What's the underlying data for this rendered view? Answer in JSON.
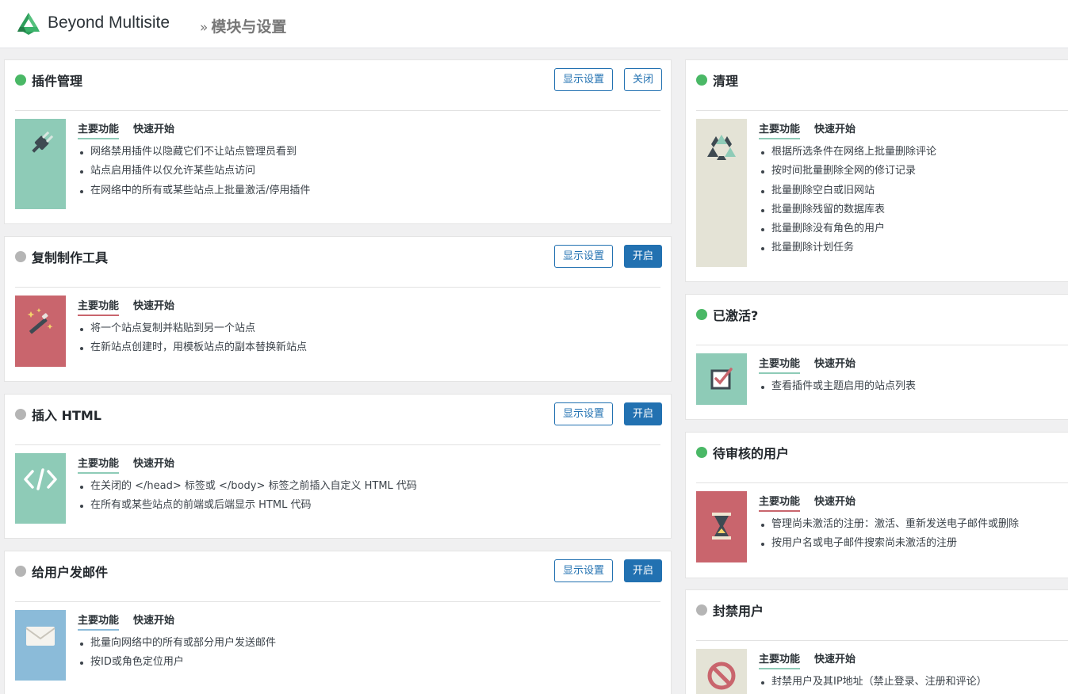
{
  "header": {
    "brand": "Beyond Multisite",
    "breadcrumb_sep": "»",
    "page_title": "模块与设置"
  },
  "colors": {
    "green_thumb": "#8ecbb7",
    "red_thumb": "#c9656d",
    "blue_thumb": "#8bbbd9",
    "beige_thumb": "#e4e3d6",
    "active_dot": "#4ab866",
    "inactive_dot": "#b5b5b5",
    "button_blue": "#2271b1"
  },
  "tab_main": "主要功能",
  "tab_quick": "快速开始",
  "modules": {
    "plugin_manager": {
      "title": "插件管理",
      "status": "active",
      "icon": "plug-icon",
      "settings_label": "显示设置",
      "toggle_label": "关闭",
      "features": [
        "网络禁用插件以隐藏它们不让站点管理员看到",
        "站点启用插件以仅允许某些站点访问",
        "在网络中的所有或某些站点上批量激活/停用插件"
      ]
    },
    "copier": {
      "title": "复制制作工具",
      "status": "inactive",
      "icon": "magic-wand-icon",
      "settings_label": "显示设置",
      "toggle_label": "开启",
      "features": [
        "将一个站点复制并粘贴到另一个站点",
        "在新站点创建时，用模板站点的副本替换新站点"
      ]
    },
    "insert_html": {
      "title": "插入 HTML",
      "status": "inactive",
      "icon": "code-icon",
      "settings_label": "显示设置",
      "toggle_label": "开启",
      "features": [
        "在关闭的 </head> 标签或 </body> 标签之前插入自定义 HTML 代码",
        "在所有或某些站点的前端或后端显示 HTML 代码"
      ]
    },
    "email_users": {
      "title": "给用户发邮件",
      "status": "inactive",
      "icon": "envelope-icon",
      "settings_label": "显示设置",
      "toggle_label": "开启",
      "features": [
        "批量向网络中的所有或部分用户发送邮件",
        "按ID或角色定位用户"
      ]
    },
    "cleanup": {
      "title": "清理",
      "status": "active",
      "icon": "recycle-icon",
      "features": [
        "根据所选条件在网络上批量删除评论",
        "按时间批量删除全网的修订记录",
        "批量删除空白或旧网站",
        "批量删除残留的数据库表",
        "批量删除没有角色的用户",
        "批量删除计划任务"
      ]
    },
    "is_active": {
      "title": "已激活?",
      "status": "active",
      "icon": "checkbox-icon",
      "features": [
        "查看插件或主题启用的站点列表"
      ]
    },
    "pending_users": {
      "title": "待审核的用户",
      "status": "active",
      "icon": "hourglass-icon",
      "features": [
        "管理尚未激活的注册：激活、重新发送电子邮件或删除",
        "按用户名或电子邮件搜索尚未激活的注册"
      ]
    },
    "ban_users": {
      "title": "封禁用户",
      "status": "inactive",
      "icon": "ban-icon",
      "features": [
        "封禁用户及其IP地址（禁止登录、注册和评论）"
      ]
    }
  }
}
